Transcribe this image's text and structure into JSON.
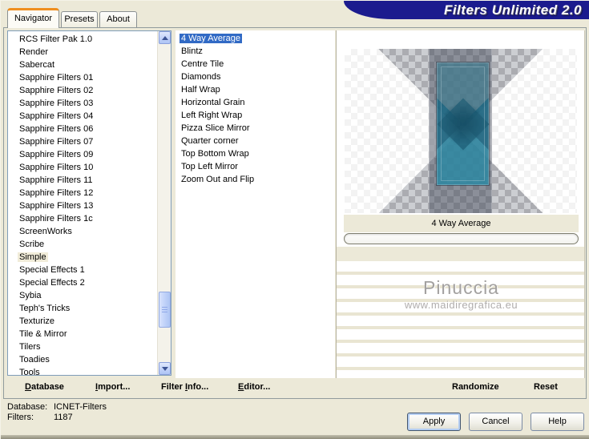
{
  "window": {
    "banner_title": "Filters Unlimited 2.0"
  },
  "tabs": [
    {
      "label": "Navigator",
      "active": true
    },
    {
      "label": "Presets",
      "active": false
    },
    {
      "label": "About",
      "active": false
    }
  ],
  "navigator_list": {
    "selected": "Simple",
    "items": [
      "RCS Filter Pak 1.0",
      "Render",
      "Sabercat",
      "Sapphire Filters 01",
      "Sapphire Filters 02",
      "Sapphire Filters 03",
      "Sapphire Filters 04",
      "Sapphire Filters 06",
      "Sapphire Filters 07",
      "Sapphire Filters 09",
      "Sapphire Filters 10",
      "Sapphire Filters 11",
      "Sapphire Filters 12",
      "Sapphire Filters 13",
      "Sapphire Filters 1c",
      "ScreenWorks",
      "Scribe",
      "Simple",
      "Special Effects 1",
      "Special Effects 2",
      "Sybia",
      "Teph's Tricks",
      "Texturize",
      "Tile & Mirror",
      "Tilers",
      "Toadies",
      "Tools"
    ]
  },
  "filter_list": {
    "selected": "4 Way Average",
    "items": [
      "4 Way Average",
      "Blintz",
      "Centre Tile",
      "Diamonds",
      "Half Wrap",
      "Horizontal Grain",
      "Left Right Wrap",
      "Pizza Slice Mirror",
      "Quarter corner",
      "Top Bottom Wrap",
      "Top Left Mirror",
      "Zoom Out and Flip"
    ]
  },
  "preview": {
    "caption": "4 Way Average",
    "watermark_name": "Pinuccia",
    "watermark_site": "www.maidiregrafica.eu"
  },
  "commands": {
    "database": {
      "pre": "",
      "key": "D",
      "post": "atabase"
    },
    "import": {
      "pre": "",
      "key": "I",
      "post": "mport..."
    },
    "filter_info": {
      "pre": "Filter ",
      "key": "I",
      "post": "nfo..."
    },
    "editor": {
      "pre": "",
      "key": "E",
      "post": "ditor..."
    },
    "randomize": {
      "label": "Randomize"
    },
    "reset": {
      "label": "Reset"
    }
  },
  "status": {
    "database_label": "Database:",
    "database_value": "ICNET-Filters",
    "filters_label": "Filters:",
    "filters_value": "1187"
  },
  "action_buttons": {
    "apply": "Apply",
    "cancel": "Cancel",
    "help": "Help"
  },
  "colors": {
    "dialog_bg": "#ece9d8",
    "banner_navy": "#1b1b8e",
    "selection_blue": "#316ac5",
    "inactive_selection": "#f1ecd9",
    "tab_accent_orange": "#ef8f1f",
    "preview_teal": "#1e7694"
  }
}
